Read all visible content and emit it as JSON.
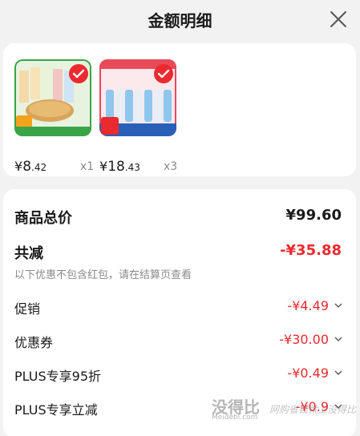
{
  "header": {
    "title": "金额明细",
    "close_icon": "close-icon"
  },
  "products": [
    {
      "price_symbol": "¥",
      "price_int": "8",
      "price_dec": ".42",
      "qty": "x1",
      "colors": {
        "border": "#3aa548",
        "bg": "#e7f3df"
      }
    },
    {
      "price_symbol": "¥",
      "price_int": "18",
      "price_dec": ".43",
      "qty": "x3",
      "colors": {
        "border": "#e84a5a",
        "bg": "#fbe9ec"
      }
    }
  ],
  "summary": {
    "total_label": "商品总价",
    "total_value": "¥99.60",
    "reduce_label": "共减",
    "reduce_value": "-¥35.88",
    "note": "以下优惠不包含红包，请在结算页查看",
    "items": [
      {
        "label": "促销",
        "value": "-¥4.49"
      },
      {
        "label": "优惠券",
        "value": "-¥30.00"
      },
      {
        "label": "PLUS专享95折",
        "value": "-¥0.49"
      },
      {
        "label": "PLUS专享立减",
        "value": "-¥0.9"
      }
    ]
  },
  "watermark": {
    "main": "没得比",
    "sub": "Meidebi.com",
    "slogan": "网购省钱就上没得比"
  },
  "colors": {
    "accent": "#ea2a2f",
    "text": "#1a1a1a",
    "muted": "#8a8a8a",
    "bg": "#f2f2f2"
  }
}
